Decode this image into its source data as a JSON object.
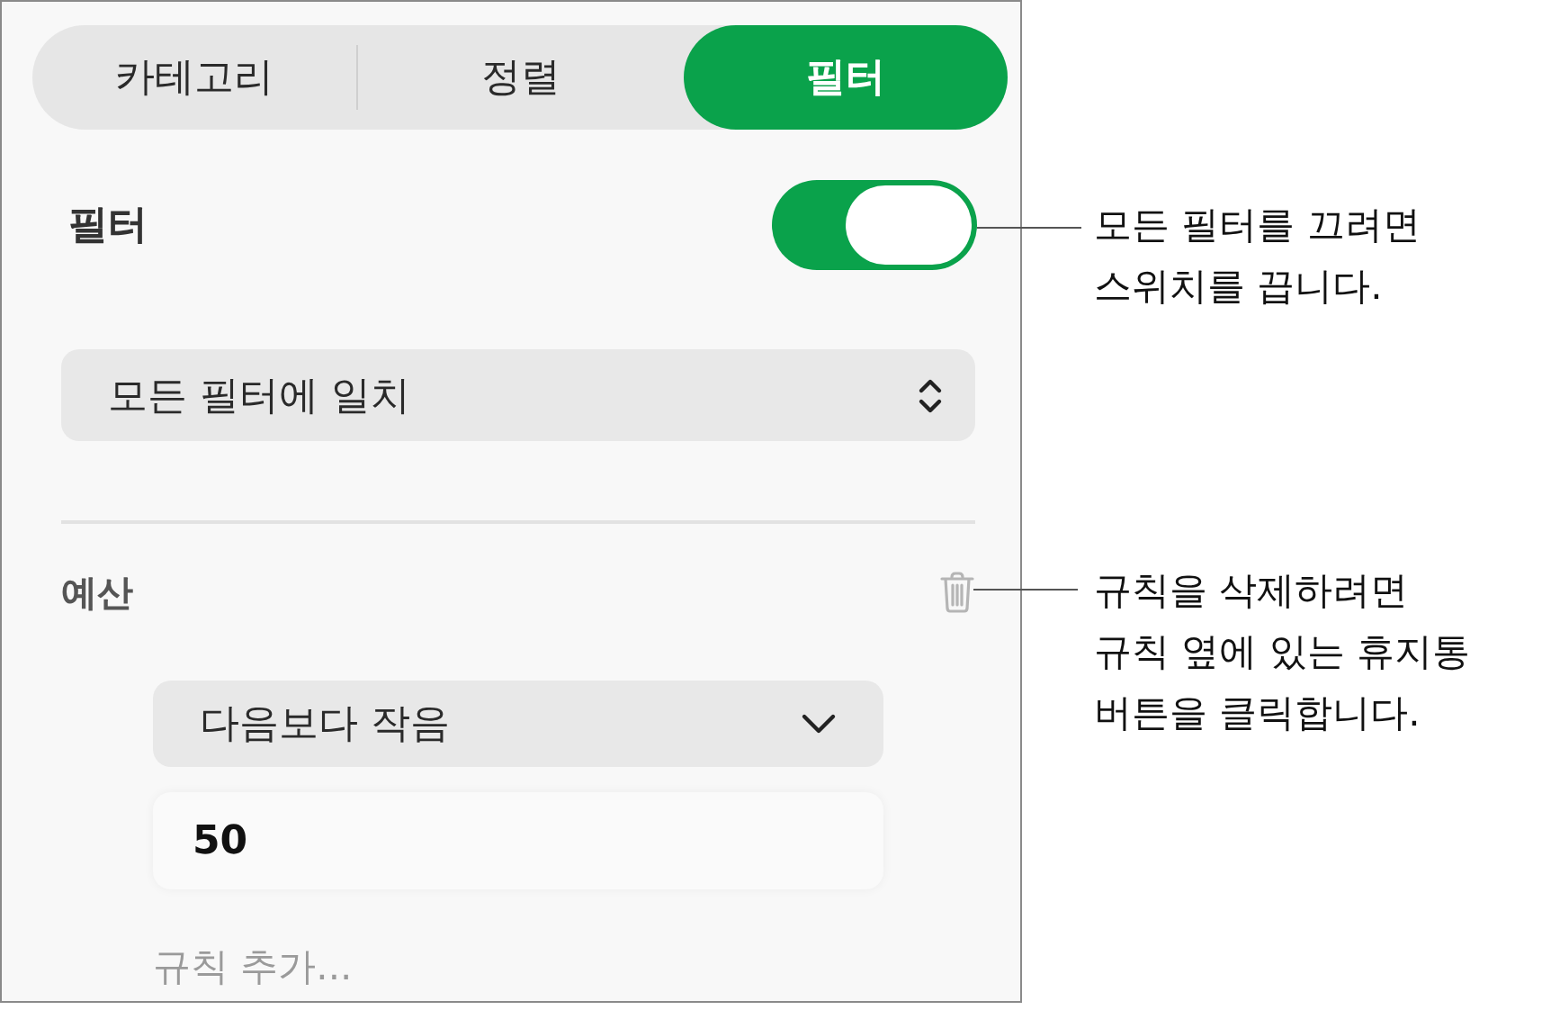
{
  "tabs": [
    {
      "label": "카테고리",
      "selected": false
    },
    {
      "label": "정렬",
      "selected": false
    },
    {
      "label": "필터",
      "selected": true
    }
  ],
  "filter_toggle": {
    "label": "필터",
    "on": true
  },
  "match_menu": {
    "value": "모든 필터에 일치"
  },
  "rules": [
    {
      "column": "예산",
      "condition": "다음보다 작음",
      "value": "50"
    }
  ],
  "add_rule": "규칙 추가...",
  "callouts": [
    {
      "text": "모든 필터를 끄려면\n스위치를 끕니다."
    },
    {
      "text": "규칙을 삭제하려면\n규칙 옆에 있는 휴지통\n버튼을 클릭합니다."
    }
  ]
}
